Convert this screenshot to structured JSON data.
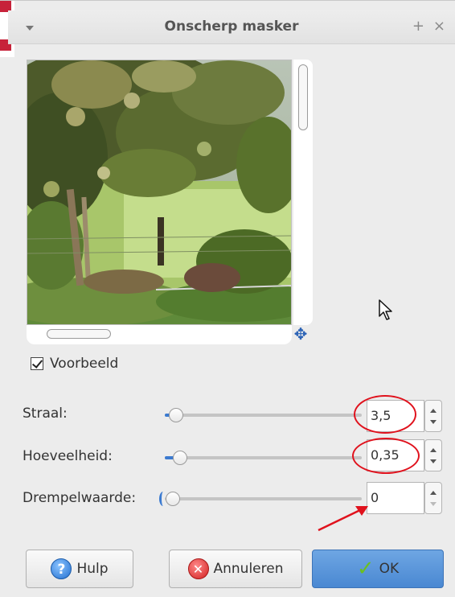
{
  "window": {
    "title": "Onscherp masker",
    "menu_icon": "chevron-down-icon",
    "pin_icon": "plus-icon",
    "close_icon": "close-icon"
  },
  "preview": {
    "checkbox_label": "Voorbeeld",
    "checked": true,
    "navigate_icon": "move-arrows-icon"
  },
  "params": [
    {
      "label": "Straal:",
      "value": "3,5",
      "level": 0.03
    },
    {
      "label": "Hoeveelheid:",
      "value": "0,35",
      "level": 0.07
    },
    {
      "label": "Drempelwaarde:",
      "value": "0",
      "level": 0.0
    }
  ],
  "buttons": {
    "help": "Hulp",
    "cancel": "Annuleren",
    "ok": "OK"
  },
  "colors": {
    "accent": "#3b7ad0",
    "annotation": "#e0121d"
  }
}
